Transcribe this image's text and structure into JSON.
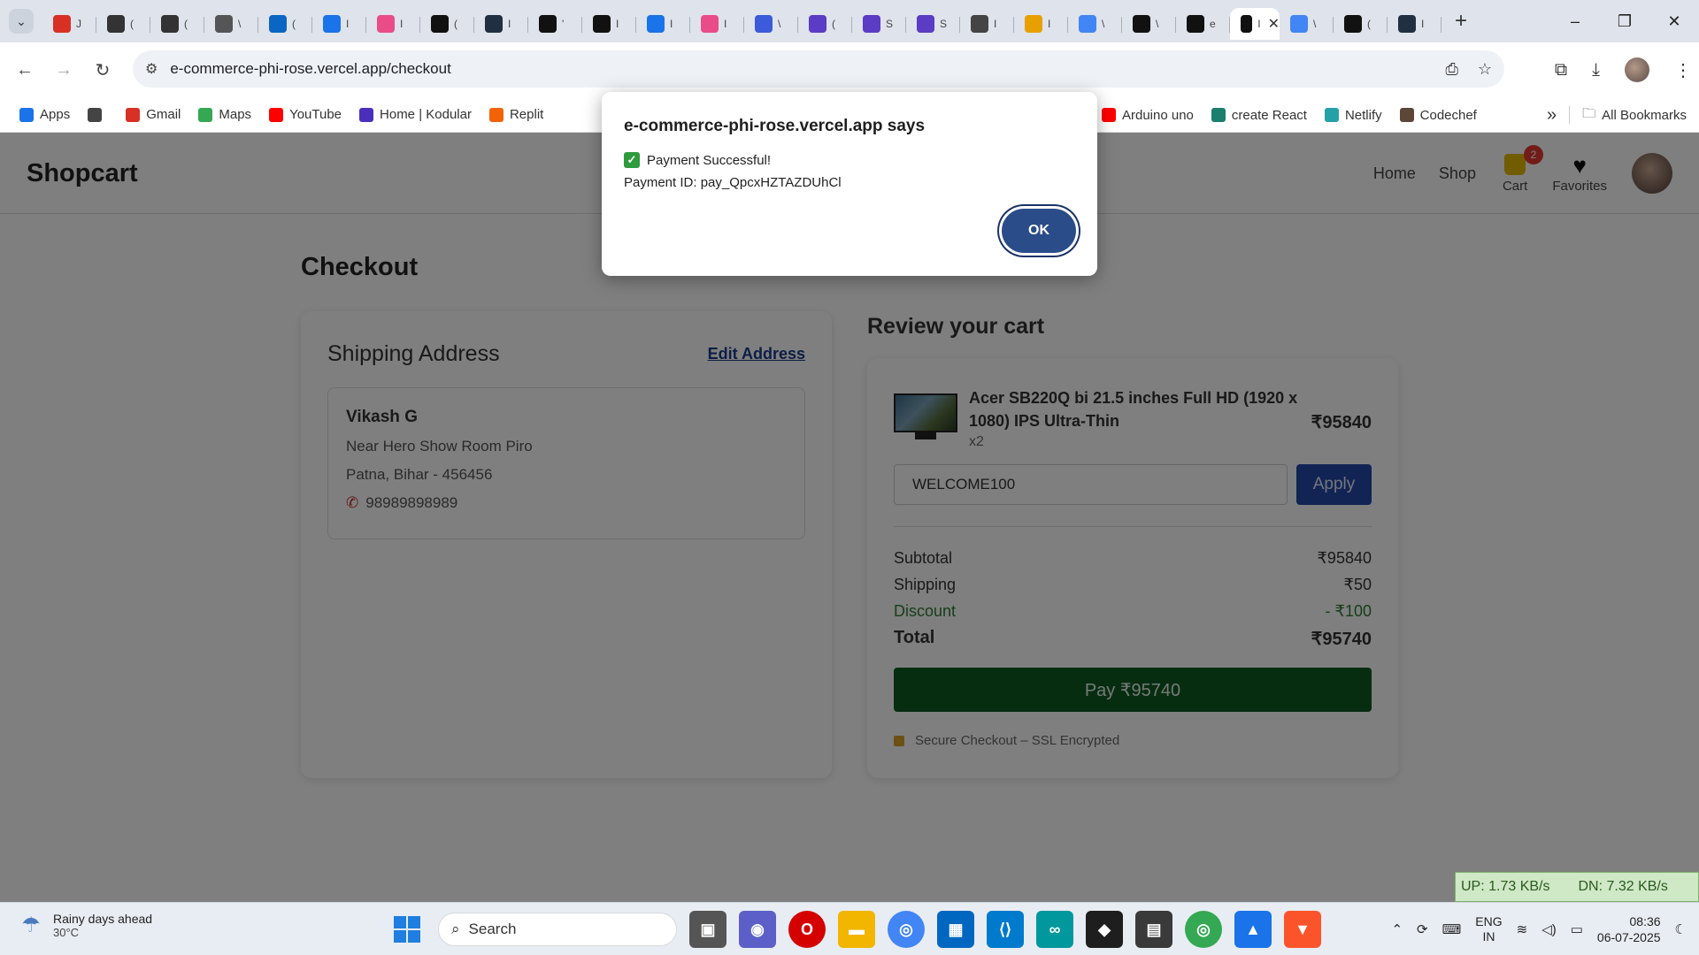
{
  "browser": {
    "url": "e-commerce-phi-rose.vercel.app/checkout",
    "tabs": [
      {
        "icon": "gmail-icon",
        "label": "J",
        "color": "#d93025"
      },
      {
        "icon": "ih-icon",
        "label": "(",
        "color": "#333333"
      },
      {
        "icon": "ih-icon",
        "label": "(",
        "color": "#333333"
      },
      {
        "icon": "globe-icon",
        "label": "\\",
        "color": "#555555"
      },
      {
        "icon": "linkedin-icon",
        "label": "(",
        "color": "#0a66c2"
      },
      {
        "icon": "history-icon",
        "label": "I",
        "color": "#1a73e8"
      },
      {
        "icon": "dribbble-icon",
        "label": "I",
        "color": "#ea4c89"
      },
      {
        "icon": "target-icon",
        "label": "(",
        "color": "#111111"
      },
      {
        "icon": "react-icon",
        "label": "I",
        "color": "#203040"
      },
      {
        "icon": "unsplash-icon",
        "label": "'",
        "color": "#111111"
      },
      {
        "icon": "s-icon",
        "label": "I",
        "color": "#111111"
      },
      {
        "icon": "download-icon",
        "label": "I",
        "color": "#1a73e8"
      },
      {
        "icon": "dribbble-icon",
        "label": "I",
        "color": "#ea4c89"
      },
      {
        "icon": "form-icon",
        "label": "\\",
        "color": "#3b5bdb"
      },
      {
        "icon": "list-icon",
        "label": "(",
        "color": "#5b3cc4"
      },
      {
        "icon": "list-icon",
        "label": "S",
        "color": "#5b3cc4"
      },
      {
        "icon": "list-icon",
        "label": "S",
        "color": "#5b3cc4"
      },
      {
        "icon": "chrome-ext-icon",
        "label": "I",
        "color": "#444444"
      },
      {
        "icon": "hat-icon",
        "label": "I",
        "color": "#e8a000"
      },
      {
        "icon": "google-icon",
        "label": "\\",
        "color": "#4285f4"
      },
      {
        "icon": "github-icon",
        "label": "\\",
        "color": "#111111"
      },
      {
        "icon": "vercel-icon",
        "label": "e",
        "color": "#111111"
      },
      {
        "icon": "active-tab-icon",
        "label": "I",
        "color": "#111111"
      },
      {
        "icon": "google-icon",
        "label": "\\",
        "color": "#4285f4"
      },
      {
        "icon": "target-icon",
        "label": "(",
        "color": "#111111"
      },
      {
        "icon": "react-icon",
        "label": "I",
        "color": "#203040"
      }
    ],
    "bookmarks": [
      {
        "icon": "apps-grid-icon",
        "label": "Apps"
      },
      {
        "icon": "tab-groups-icon",
        "label": ""
      },
      {
        "icon": "gmail-icon",
        "label": "Gmail"
      },
      {
        "icon": "maps-icon",
        "label": "Maps"
      },
      {
        "icon": "youtube-icon",
        "label": "YouTube"
      },
      {
        "icon": "kodular-icon",
        "label": "Home | Kodular"
      },
      {
        "icon": "replit-icon",
        "label": "Replit"
      }
    ],
    "bookmarks_right": [
      {
        "icon": "youtube-icon",
        "label": "Arduino uno"
      },
      {
        "icon": "react-icon",
        "label": "create React"
      },
      {
        "icon": "netlify-icon",
        "label": "Netlify"
      },
      {
        "icon": "codechef-icon",
        "label": "Codechef"
      }
    ],
    "more_bookmarks": "»",
    "all_bookmarks": "All Bookmarks"
  },
  "site": {
    "logo": "Shopcart",
    "nav": {
      "home": "Home",
      "shop": "Shop",
      "cart": "Cart",
      "cart_count": "2",
      "favorites": "Favorites"
    }
  },
  "checkout": {
    "title": "Checkout",
    "shipping": {
      "title": "Shipping Address",
      "edit": "Edit Address",
      "name": "Vikash G",
      "line1": "Near Hero Show Room Piro",
      "line2": "Patna, Bihar - 456456",
      "phone": "98989898989"
    },
    "review": {
      "title": "Review your cart",
      "item_name": "Acer SB220Q bi 21.5 inches Full HD (1920 x 1080) IPS Ultra-Thin",
      "item_qty": "x2",
      "item_price": "₹95840",
      "coupon_value": "WELCOME100",
      "apply": "Apply",
      "subtotal_label": "Subtotal",
      "subtotal": "₹95840",
      "shipping_label": "Shipping",
      "shipping": "₹50",
      "discount_label": "Discount",
      "discount": "- ₹100",
      "total_label": "Total",
      "total": "₹95740",
      "pay": "Pay ₹95740",
      "secure": "Secure Checkout – SSL Encrypted"
    }
  },
  "dialog": {
    "title": "e-commerce-phi-rose.vercel.app says",
    "message": "Payment Successful!",
    "payment_id": "Payment ID: pay_QpcxHZTAZDUhCl",
    "ok": "OK"
  },
  "netspeed": {
    "up": "UP: 1.73 KB/s",
    "down": "DN: 7.32 KB/s"
  },
  "taskbar": {
    "weather_title": "Rainy days ahead",
    "weather_temp": "30°C",
    "search": "Search",
    "lang1": "ENG",
    "lang2": "IN",
    "time": "08:36",
    "date": "06-07-2025"
  }
}
